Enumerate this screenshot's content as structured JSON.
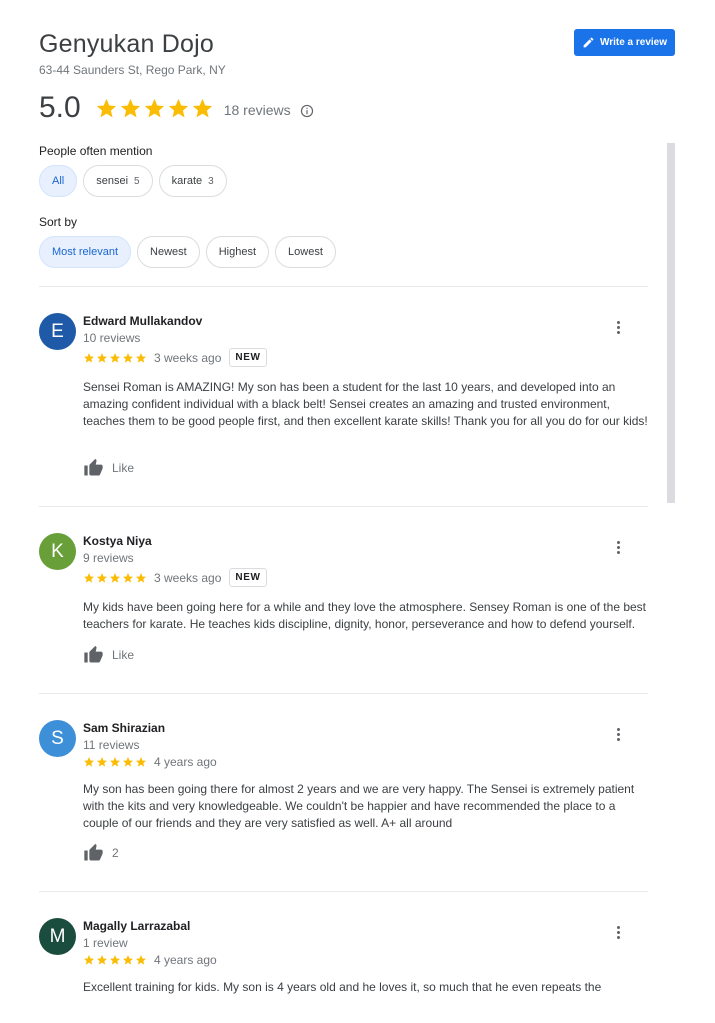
{
  "place": {
    "title": "Genyukan Dojo",
    "address": "63-44 Saunders St, Rego Park, NY",
    "rating": "5.0",
    "reviews_label": "18 reviews",
    "write_review_label": "Write a review"
  },
  "mentions": {
    "label": "People often mention",
    "chips": [
      {
        "label": "All",
        "count": ""
      },
      {
        "label": "sensei",
        "count": "5"
      },
      {
        "label": "karate",
        "count": "3"
      }
    ]
  },
  "sort": {
    "label": "Sort by",
    "options": [
      "Most relevant",
      "Newest",
      "Highest",
      "Lowest"
    ]
  },
  "colors": {
    "accent": "#1a73e8",
    "star": "#fbbc04"
  },
  "reviews": [
    {
      "initial": "E",
      "avatar_color": "#1e5aa8",
      "name": "Edward Mullakandov",
      "count": "10 reviews",
      "stars": 5,
      "time": "3 weeks ago",
      "badge": "NEW",
      "text": "Sensei Roman is AMAZING! My son has been a student for the last 10 years, and developed into an amazing confident individual with a black belt! Sensei creates an amazing and trusted environment, teaches them to be good people first, and then excellent karate skills! Thank you for all you do for our kids!",
      "like": "Like"
    },
    {
      "initial": "K",
      "avatar_color": "#689f38",
      "name": "Kostya Niya",
      "count": "9 reviews",
      "stars": 5,
      "time": "3 weeks ago",
      "badge": "NEW",
      "text": "My kids have been going here for a while and they love the atmosphere. Sensey Roman is one of the best teachers for karate. He teaches kids discipline, dignity, honor, perseverance and how to defend yourself.",
      "like": "Like"
    },
    {
      "initial": "S",
      "avatar_color": "#3d8fd8",
      "name": "Sam Shirazian",
      "count": "11 reviews",
      "stars": 5,
      "time": "4 years ago",
      "badge": "",
      "text": "My son has been going there for almost 2 years and we are very happy.  The Sensei is extremely patient with the kits and very knowledgeable.  We couldn't be happier and have recommended the place to a couple of our friends and they are very satisfied as well.  A+ all around",
      "like": "2"
    },
    {
      "initial": "M",
      "avatar_color": "#1b4d3e",
      "name": "Magally Larrazabal",
      "count": "1 review",
      "stars": 5,
      "time": "4 years ago",
      "badge": "",
      "text": "Excellent training for kids. My son is 4 years old and he loves it, so much that he even repeats the",
      "like": ""
    }
  ]
}
